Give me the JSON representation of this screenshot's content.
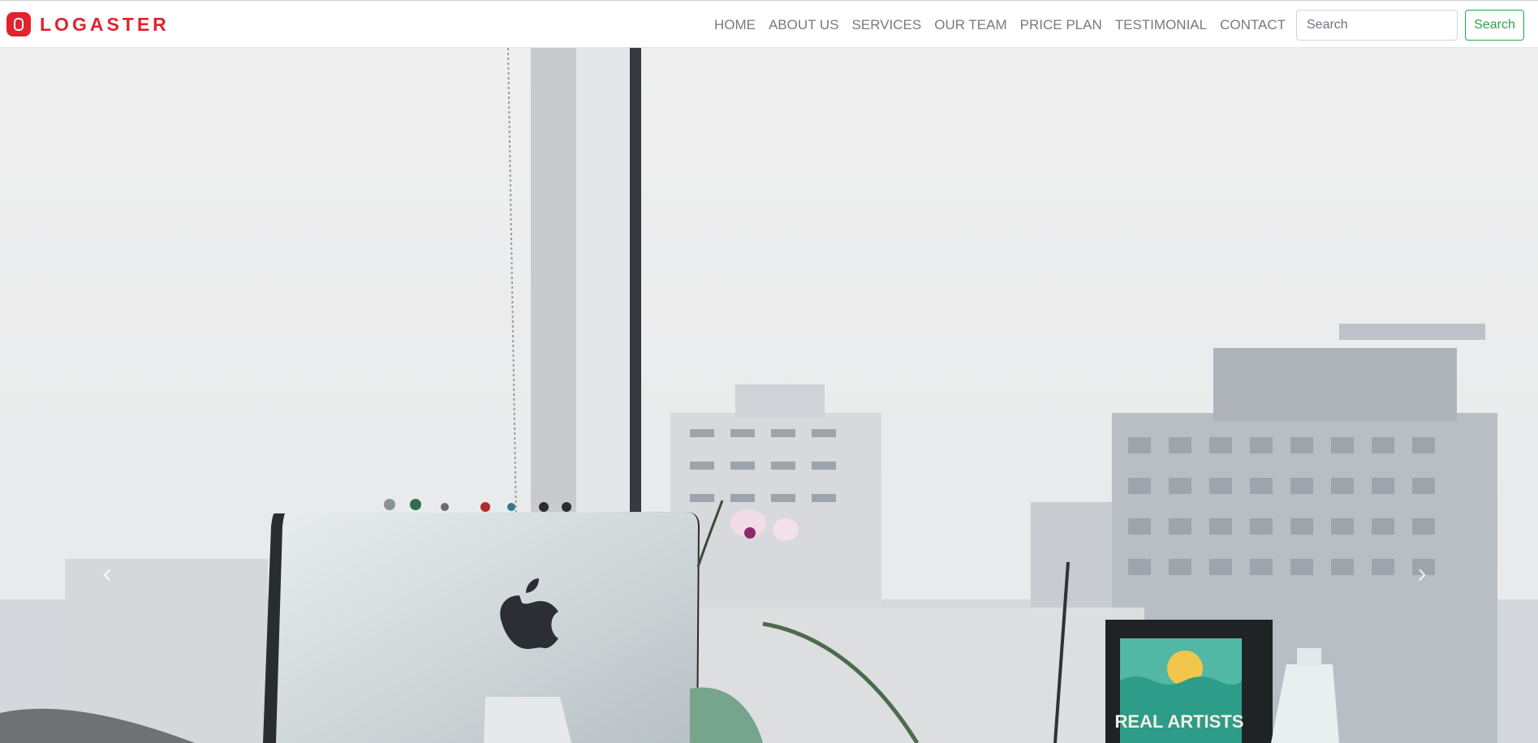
{
  "brand": {
    "name": "LOGASTER",
    "color": "#e1232f"
  },
  "nav": {
    "items": [
      {
        "label": "HOME"
      },
      {
        "label": "ABOUT US"
      },
      {
        "label": "SERVICES"
      },
      {
        "label": "OUR TEAM"
      },
      {
        "label": "PRICE PLAN"
      },
      {
        "label": "TESTIMONIAL"
      },
      {
        "label": "CONTACT"
      }
    ]
  },
  "search": {
    "placeholder": "Search",
    "value": "",
    "button_label": "Search",
    "accent": "#28a745"
  },
  "hero": {
    "poster_text": "REAL ARTISTS",
    "icons": {
      "prev": "chevron-left-icon",
      "next": "chevron-right-icon"
    }
  }
}
